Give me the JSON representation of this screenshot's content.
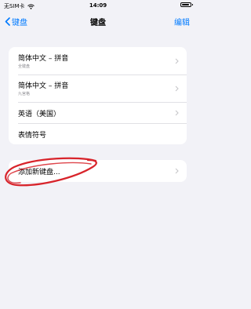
{
  "status": {
    "carrier": "无SIM卡",
    "time": "14:09",
    "battery_level": 0.85
  },
  "nav": {
    "back_label": "键盘",
    "title": "键盘",
    "edit_label": "编辑"
  },
  "keyboards": [
    {
      "title": "简体中文 – 拼音",
      "subtitle": "全键盘"
    },
    {
      "title": "简体中文 – 拼音",
      "subtitle": "九宫格"
    },
    {
      "title": "英语（美国）"
    },
    {
      "title": "表情符号"
    }
  ],
  "add_keyboard": {
    "label": "添加新键盘..."
  },
  "colors": {
    "accent": "#007aff",
    "background": "#f2f2f7",
    "annotation": "#d8242b"
  },
  "icons": [
    "wifi-icon",
    "battery-icon",
    "chevron-left-icon",
    "chevron-right-icon"
  ]
}
